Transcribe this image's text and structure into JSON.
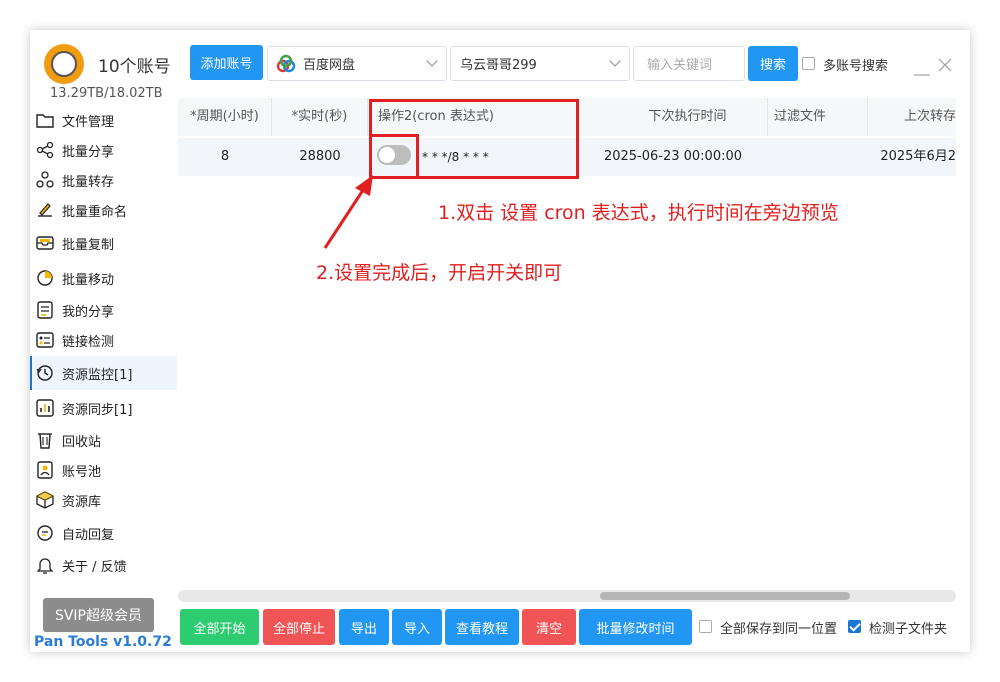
{
  "header": {
    "app_title": "10个账号",
    "storage": "13.29TB/18.02TB",
    "add_account": "添加账号",
    "drive_select": "百度网盘",
    "account_select": "乌云哥哥299",
    "keyword_placeholder": "输入关键词",
    "search_button": "搜索",
    "multi_account_search": "多账号搜索"
  },
  "sidebar": {
    "items": [
      {
        "label": "文件管理",
        "icon": "folder-icon"
      },
      {
        "label": "批量分享",
        "icon": "share-icon"
      },
      {
        "label": "批量转存",
        "icon": "transfer-icon"
      },
      {
        "label": "批量重命名",
        "icon": "rename-icon"
      },
      {
        "label": "批量复制",
        "icon": "copy-icon"
      },
      {
        "label": "批量移动",
        "icon": "move-icon"
      },
      {
        "label": "我的分享",
        "icon": "my-share-icon"
      },
      {
        "label": "链接检测",
        "icon": "link-check-icon"
      },
      {
        "label": "资源监控[1]",
        "icon": "monitor-icon"
      },
      {
        "label": "资源同步[1]",
        "icon": "sync-icon"
      },
      {
        "label": "回收站",
        "icon": "trash-icon"
      },
      {
        "label": "账号池",
        "icon": "account-pool-icon"
      },
      {
        "label": "资源库",
        "icon": "resource-icon"
      },
      {
        "label": "自动回复",
        "icon": "auto-reply-icon"
      },
      {
        "label": "关于 / 反馈",
        "icon": "bell-icon"
      }
    ],
    "vip": "SVIP超级会员",
    "version": "Pan Tools v1.0.72"
  },
  "table": {
    "columns": [
      "*周期(小时)",
      "*实时(秒)",
      "操作2(cron 表达式)",
      "下次执行时间",
      "过滤文件",
      "上次转存"
    ],
    "rows": [
      {
        "period": "8",
        "realtime": "28800",
        "cron": "* * */8 * * *",
        "next_run": "2025-06-23 00:00:00",
        "filter": "",
        "last_transfer": "2025年6月2"
      }
    ]
  },
  "annotations": {
    "step1": "1.双击 设置 cron 表达式，执行时间在旁边预览",
    "step2": "2.设置完成后，开启开关即可"
  },
  "footer": {
    "buttons": [
      "全部开始",
      "全部停止",
      "导出",
      "导入",
      "查看教程",
      "清空",
      "批量修改时间"
    ],
    "save_same_location": "全部保存到同一位置",
    "check_subfolders": "检测子文件夹"
  },
  "colors": {
    "accent": "#2196f3",
    "start": "#2ecc71",
    "stop": "#f05454",
    "annotation": "#e02020"
  }
}
